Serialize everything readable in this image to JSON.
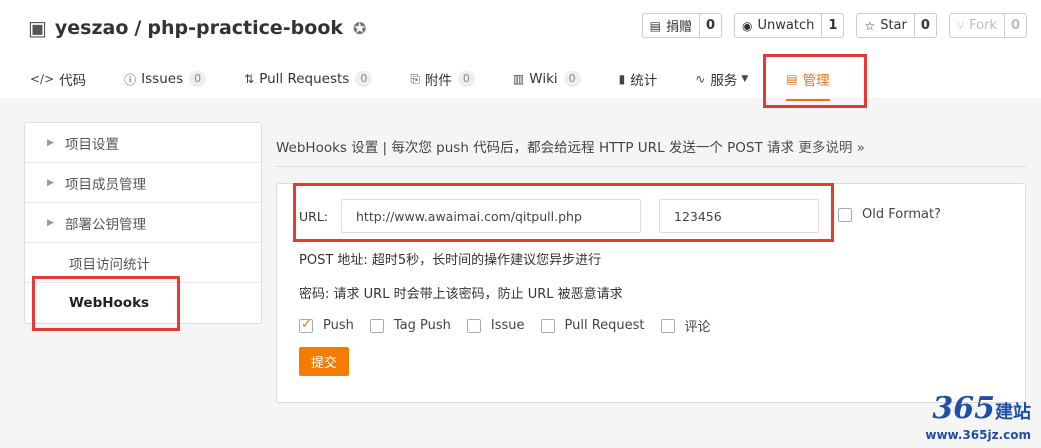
{
  "repo": {
    "owner": "yeszao",
    "separator": "/",
    "name": "php-practice-book"
  },
  "actions": [
    {
      "label": "捐赠",
      "count": "0",
      "icon": "donate-icon"
    },
    {
      "label": "Unwatch",
      "count": "1",
      "icon": "eye-icon"
    },
    {
      "label": "Star",
      "count": "0",
      "icon": "star-icon"
    },
    {
      "label": "Fork",
      "count": "0",
      "icon": "fork-icon"
    }
  ],
  "tabs": [
    {
      "label": "代码",
      "icon": "code-icon"
    },
    {
      "label": "Issues",
      "count": "0",
      "icon": "issue-icon"
    },
    {
      "label": "Pull Requests",
      "count": "0",
      "icon": "pull-request-icon"
    },
    {
      "label": "附件",
      "count": "0",
      "icon": "paperclip-icon"
    },
    {
      "label": "Wiki",
      "count": "0",
      "icon": "book-icon"
    },
    {
      "label": "统计",
      "icon": "bar-chart-icon"
    },
    {
      "label": "服务",
      "icon": "pulse-icon"
    },
    {
      "label": "管理",
      "icon": "settings-doc-icon"
    }
  ],
  "sidebar": {
    "items": [
      {
        "label": "项目设置"
      },
      {
        "label": "项目成员管理"
      },
      {
        "label": "部署公钥管理"
      },
      {
        "label": "项目访问统计"
      },
      {
        "label": "WebHooks"
      }
    ]
  },
  "webhooks": {
    "description": "WebHooks 设置 | 每次您 push 代码后，都会给远程 HTTP URL 发送一个 POST 请求",
    "more_link": "更多说明 »",
    "url_label": "URL:",
    "url_value": "http://www.awaimai.com/qitpull.php",
    "password_value": "123456",
    "old_format_label": "Old Format?",
    "post_note": "POST 地址: 超时5秒，长时间的操作建议您异步进行",
    "password_note": "密码: 请求 URL 时会带上该密码，防止 URL 被恶意请求",
    "events": [
      {
        "label": "Push",
        "checked": true
      },
      {
        "label": "Tag Push",
        "checked": false
      },
      {
        "label": "Issue",
        "checked": false
      },
      {
        "label": "Pull Request",
        "checked": false
      },
      {
        "label": "评论",
        "checked": false
      }
    ],
    "submit_label": "提交"
  },
  "watermark": {
    "number": "365",
    "text": "建站",
    "url": "www.365jz.com"
  },
  "colors": {
    "accent": "#f57c00",
    "highlight_box": "#e53935"
  }
}
